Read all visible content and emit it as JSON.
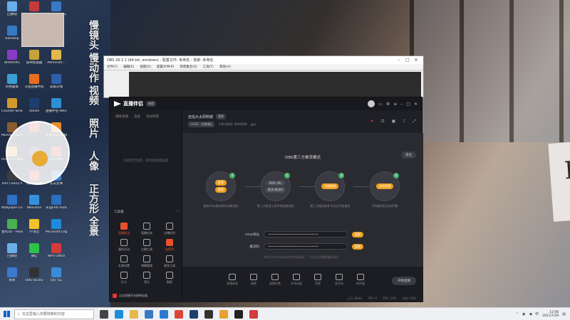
{
  "desktop": {
    "icons": [
      {
        "label": "回收站",
        "color": "#6ab0e8"
      },
      {
        "label": "大牛影...",
        "color": "#c53a3a"
      },
      {
        "label": "QQ飞车完整工具",
        "color": "#3a78c5"
      },
      {
        "label": "Bandizip",
        "color": "#3479c4"
      },
      {
        "label": "流行叶开心",
        "color": "#d48a32"
      },
      {
        "label": "iClone",
        "color": "#3c6bbd"
      },
      {
        "label": "BRAVOVG",
        "color": "#8a3ac5"
      },
      {
        "label": "雷神加速器",
        "color": "#c5a23a"
      },
      {
        "label": "Administr...",
        "color": "#e0b94a"
      },
      {
        "label": "控制面板",
        "color": "#3aa0d4"
      },
      {
        "label": "斗鱼直播伴侣",
        "color": "#e86d1f"
      },
      {
        "label": "穿越火线",
        "color": "#2f5fa8"
      },
      {
        "label": "Counter-Strike Global Off...",
        "color": "#d39a2a"
      },
      {
        "label": "Steam",
        "color": "#1c3f6e"
      },
      {
        "label": "直播伴侣 WeGame...",
        "color": "#2d8fd5"
      },
      {
        "label": "Monster Hunter...",
        "color": "#8a5b2e"
      },
      {
        "label": "",
        "color": "#cc4444"
      },
      {
        "label": "守望先锋 英雄联盟",
        "color": "#e58a2a"
      },
      {
        "label": "PLAYER UNKNO...",
        "color": "#d6a63a"
      },
      {
        "label": "",
        "color": "#555555"
      },
      {
        "label": "风行视频",
        "color": "#c94545"
      },
      {
        "label": "Tom Clancy's R...",
        "color": "#3d3d3d"
      },
      {
        "label": "风雨守护者",
        "color": "#e04b4b"
      },
      {
        "label": "实况足球",
        "color": "#3b7fd0"
      },
      {
        "label": "Wallpaper Engine:...",
        "color": "#2f6fc5"
      },
      {
        "label": "WeGame",
        "color": "#3690e0"
      },
      {
        "label": "光电ERA Audio...",
        "color": "#2b6fbf"
      },
      {
        "label": "金鸡2D - Poolians",
        "color": "#4caf50"
      },
      {
        "label": "YY语音",
        "color": "#f3c12a"
      },
      {
        "label": "Microsoft Edge",
        "color": "#1d8bd9"
      },
      {
        "label": "回收站",
        "color": "#6ab0e8"
      },
      {
        "label": "微信",
        "color": "#2ec14b"
      },
      {
        "label": "WPS Office",
        "color": "#d43a3a"
      },
      {
        "label": "网易",
        "color": "#3a7ad0"
      },
      {
        "label": "OBS Studio",
        "color": "#333333"
      },
      {
        "label": "QQ飞车",
        "color": "#3a8ad8"
      }
    ],
    "vertical_nav": [
      "慢镜头",
      "慢动作",
      "视频",
      "照片",
      "人像",
      "正方形",
      "全景"
    ]
  },
  "bag_text": "LOEWE",
  "obs": {
    "title": "OBS 26.1.1 (64-bit, windows) - 配置文件: 未命名 - 场景: 未命名",
    "menu": [
      "文件(F)",
      "编辑(E)",
      "视图(V)",
      "配置文件(P)",
      "场景集合(S)",
      "工具(T)",
      "帮助(H)"
    ]
  },
  "app": {
    "name": "直播伴侣",
    "badge": "体验",
    "scene_tabs": [
      "横屏直播",
      "竖屏",
      "添加场景"
    ],
    "scene_empty": "当前暂无场景，请添加直播画面",
    "tools_title": "工具箱",
    "tools": [
      {
        "label": "直播推流",
        "on": true
      },
      {
        "label": "直播任务",
        "on": false
      },
      {
        "label": "主播任务",
        "on": false
      },
      {
        "label": "福利活动",
        "on": false
      },
      {
        "label": "主播工具",
        "on": false
      },
      {
        "label": "连线PK",
        "on": true
      },
      {
        "label": "礼物设置",
        "on": false
      },
      {
        "label": "弹幕管理",
        "on": false
      },
      {
        "label": "更多工具",
        "on": false
      },
      {
        "label": "打卡",
        "on": false
      },
      {
        "label": "音乐",
        "on": false
      },
      {
        "label": "贴纸",
        "on": false
      }
    ],
    "left_footer": "点击直播开启更新加速",
    "room": {
      "title": "自拍大太阳明镜",
      "tag": "更换",
      "category": "CLGO - 完美钢区",
      "id": "小黑马房间: 8246848",
      "fans": "847"
    },
    "mode_title": "OBS第三方推流模式",
    "exit_label": "退出",
    "steps": [
      {
        "num": "1",
        "pill_top": "推荐",
        "pill_bottom": "推荐",
        "desc": "复制rtmp推流地址和推流码"
      },
      {
        "num": "2",
        "pill_top": "RMS URL",
        "pill_bottom": "推流·推流码",
        "desc": "第三方推流工具中粘贴推流码"
      },
      {
        "num": "3",
        "pill_top": "开始推流",
        "pill_bottom": "",
        "desc": "第三方推流软件中点击开始推流"
      },
      {
        "num": "4",
        "pill_top": "自动开播",
        "pill_bottom": "",
        "desc": "开始推流后自动开播"
      }
    ],
    "fields": [
      {
        "label": "rtmp地址",
        "value": "••••••••••••••••••••••••••••••",
        "btn": "复制"
      },
      {
        "label": "推流码",
        "value": "••••••••••••••••••••••••••••••",
        "btn": "复制"
      }
    ],
    "field_hint": "本地分享rtmp推流地址和推流码，下次开启直播需重新填写",
    "bottom_tools": [
      "直播画面",
      "美颜",
      "直播布置",
      "开场动画",
      "音频",
      "麦克风",
      "扬声器"
    ],
    "start_label": "开始直播",
    "status": [
      "上行: 0kb/s",
      "FPS: 0",
      "CPU: 12%",
      "内存: 43%"
    ]
  },
  "taskbar": {
    "search_placeholder": "在这里输入你要搜索的内容",
    "apps": [
      {
        "name": "task-view",
        "color": "#444444"
      },
      {
        "name": "edge",
        "color": "#1d8bd9"
      },
      {
        "name": "file-explorer",
        "color": "#e8b84a"
      },
      {
        "name": "store",
        "color": "#3a78c5"
      },
      {
        "name": "mail",
        "color": "#2a7ad0"
      },
      {
        "name": "chrome",
        "color": "#db4437"
      },
      {
        "name": "steam",
        "color": "#1c3f6e"
      },
      {
        "name": "obs",
        "color": "#333333"
      },
      {
        "name": "wegame",
        "color": "#e8a030"
      },
      {
        "name": "douyin",
        "color": "#222222"
      },
      {
        "name": "live-partner",
        "color": "#d33b3b"
      }
    ],
    "time": "12:06",
    "date": "2021/7/29"
  }
}
